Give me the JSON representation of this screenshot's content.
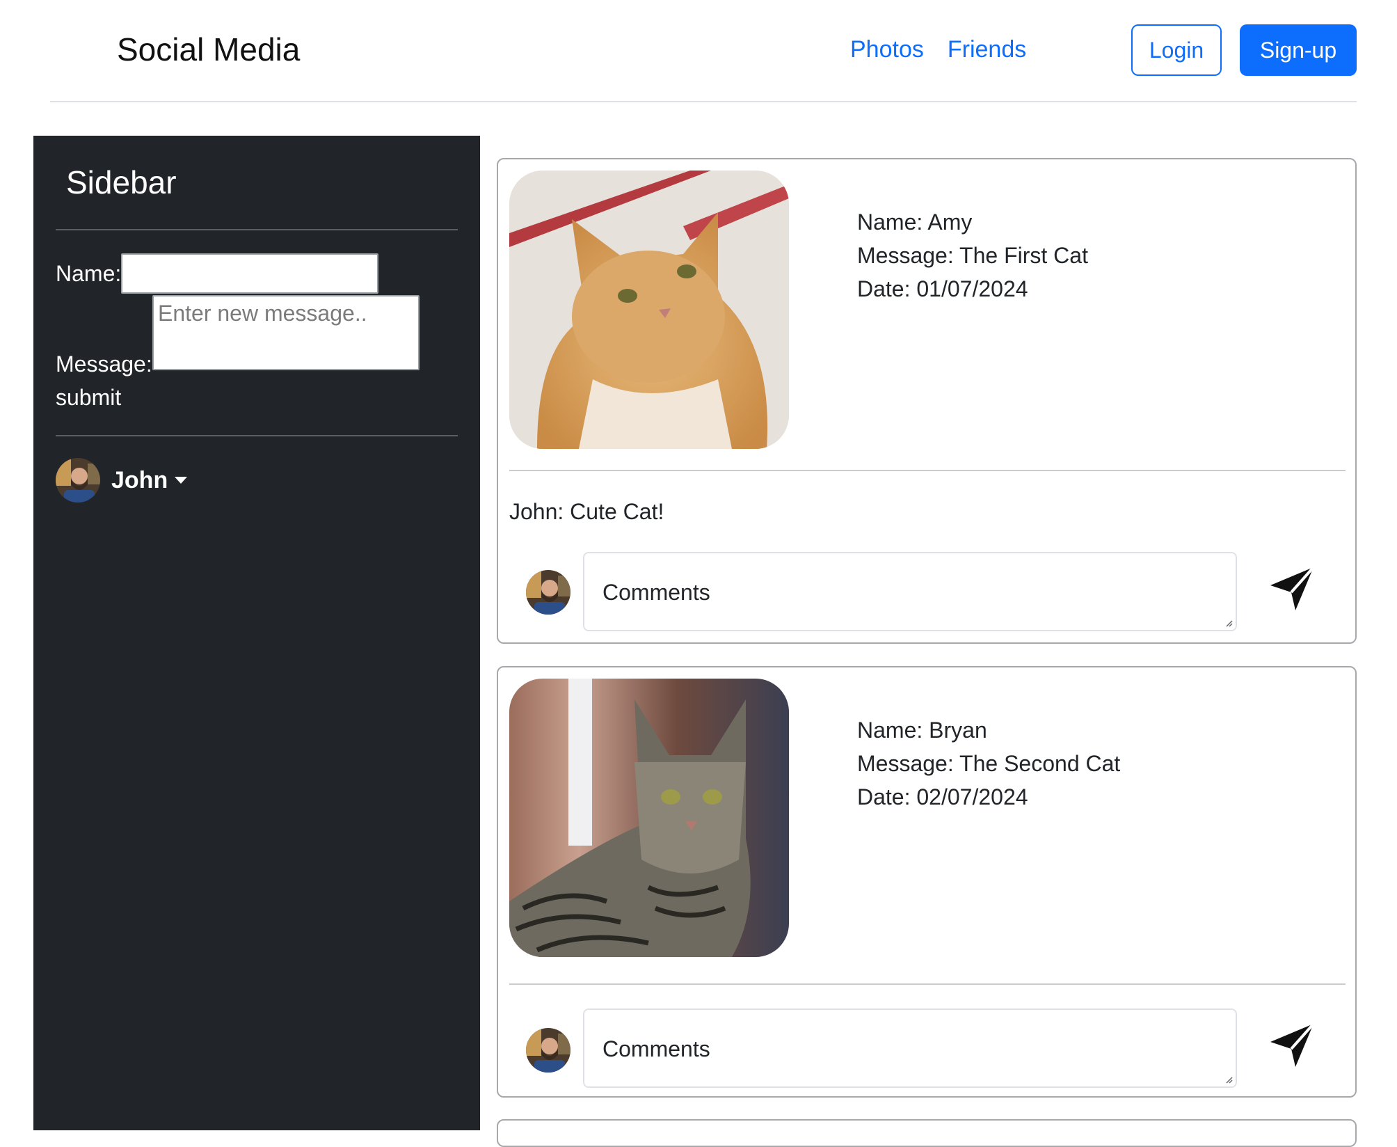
{
  "header": {
    "brand": "Social Media",
    "nav": [
      "Photos",
      "Friends"
    ],
    "login_label": "Login",
    "signup_label": "Sign-up"
  },
  "sidebar": {
    "title": "Sidebar",
    "name_label": "Name:",
    "name_value": "",
    "message_label": "Message:",
    "message_placeholder": "Enter new message..",
    "submit_label": "submit",
    "user_name": "John"
  },
  "posts": [
    {
      "name": "Name: Amy",
      "message": "Message: The First Cat",
      "date": "Date: 01/07/2024",
      "comments": [
        "John: Cute Cat!"
      ],
      "comment_placeholder": "Comments"
    },
    {
      "name": "Name: Bryan",
      "message": "Message: The Second Cat",
      "date": "Date: 02/07/2024",
      "comments": [],
      "comment_placeholder": "Comments"
    }
  ],
  "colors": {
    "accent": "#0d6efd",
    "sidebar_bg": "#212529"
  },
  "icons": [
    "caret-down-icon",
    "send-icon",
    "avatar"
  ]
}
